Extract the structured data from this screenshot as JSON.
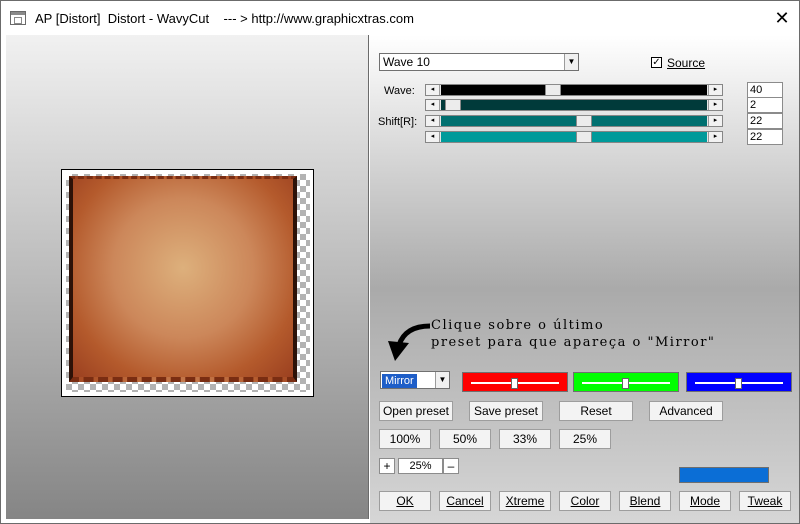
{
  "window": {
    "title": "AP [Distort]  Distort - WavyCut    --- > http://www.graphicxtras.com"
  },
  "controls": {
    "preset": "Wave 10",
    "source_label": "Source",
    "source_checked": true,
    "wave_label": "Wave:",
    "shift_label": "Shift[R]:",
    "sliders": [
      {
        "value": "40"
      },
      {
        "value": "2"
      },
      {
        "value": "22"
      },
      {
        "value": "22"
      }
    ]
  },
  "annotation": {
    "line1": "Clique sobre o último",
    "line2": "preset para que apareça o \"Mirror\""
  },
  "mode_select": {
    "value": "Mirror"
  },
  "color_sliders": [
    {
      "color": "#ff0000"
    },
    {
      "color": "#00ff00"
    },
    {
      "color": "#0000ff"
    }
  ],
  "buttons": {
    "open_preset": "Open preset",
    "save_preset": "Save preset",
    "reset": "Reset",
    "advanced": "Advanced"
  },
  "zoom": {
    "options": [
      "100%",
      "50%",
      "33%",
      "25%"
    ],
    "plus": "+",
    "minus": "–",
    "current": "25%"
  },
  "swatch_color": "#0b6ed6",
  "bottom_buttons": [
    "OK",
    "Cancel",
    "Xtreme",
    "Color",
    "Blend",
    "Mode",
    "Tweak"
  ],
  "icons": {
    "app": "window-icon",
    "close": "close-icon",
    "annotation_arrow": "curved-arrow-icon",
    "dropdown": "dropdown-arrow-icon"
  }
}
